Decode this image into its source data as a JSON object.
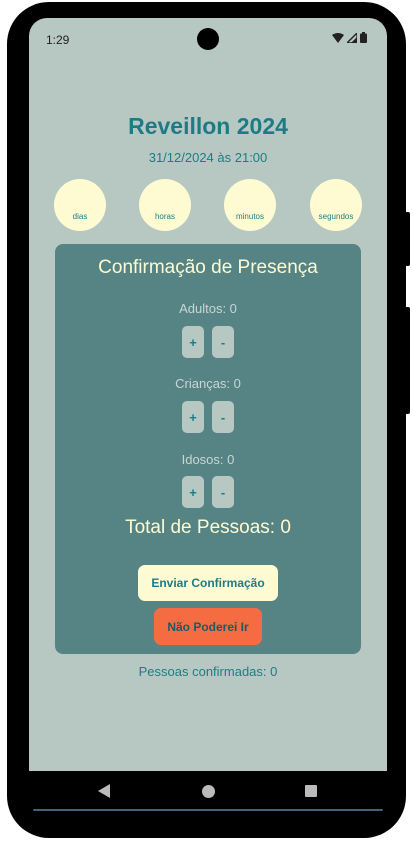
{
  "status_bar": {
    "time": "1:29",
    "icons": [
      "wifi-icon",
      "signal-icon",
      "battery-icon"
    ]
  },
  "header": {
    "title": "Reveillon 2024",
    "datetime": "31/12/2024 às 21:00"
  },
  "countdown": [
    {
      "unit": "dias"
    },
    {
      "unit": "horas"
    },
    {
      "unit": "minutos"
    },
    {
      "unit": "segundos"
    }
  ],
  "rsvp": {
    "title": "Confirmação de Presença",
    "adults_label": "Adultos: 0",
    "children_label": "Crianças: 0",
    "seniors_label": "Idosos: 0",
    "plus": "+",
    "minus": "-",
    "total": "Total de Pessoas: 0",
    "confirm_button": "Enviar Confirmação",
    "decline_button": "Não Poderei Ir"
  },
  "footer": {
    "confirmed_text": "Pessoas confirmadas: 0"
  },
  "nav": {
    "icons": [
      "back-icon",
      "home-icon",
      "recents-icon"
    ]
  },
  "colors": {
    "background": "#b7c8c3",
    "accent": "#1e7b86",
    "card": "#568383",
    "cream": "#fefbd3",
    "decline": "#f56c43"
  }
}
